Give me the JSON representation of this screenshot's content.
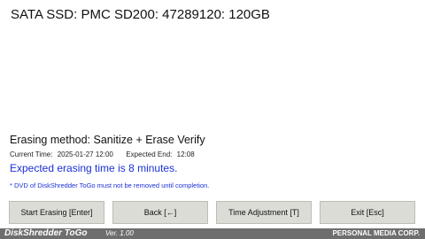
{
  "device": {
    "title": "SATA SSD: PMC SD200: 47289120: 120GB"
  },
  "erase": {
    "method_text": "Erasing method: Sanitize + Erase Verify",
    "current_time_label": "Current Time:",
    "current_time_value": "2025-01-27 12:00",
    "expected_end_label": "Expected End:",
    "expected_end_value": "12:08",
    "expected_text": "Expected erasing time is 8 minutes.",
    "warning_text": "* DVD of DiskShredder ToGo must not be removed until completion."
  },
  "buttons": {
    "start": "Start Erasing [Enter]",
    "back": "Back [←]",
    "time_adjust": "Time Adjustment [T]",
    "exit": "Exit [Esc]"
  },
  "footer": {
    "brand": "DiskShredder ToGo",
    "version": "Ver. 1.00",
    "company": "PERSONAL MEDIA CORP."
  },
  "colors": {
    "accent_blue": "#1a30d8",
    "button_bg": "#dcdcd6",
    "footer_bg": "#6e6e6e"
  }
}
